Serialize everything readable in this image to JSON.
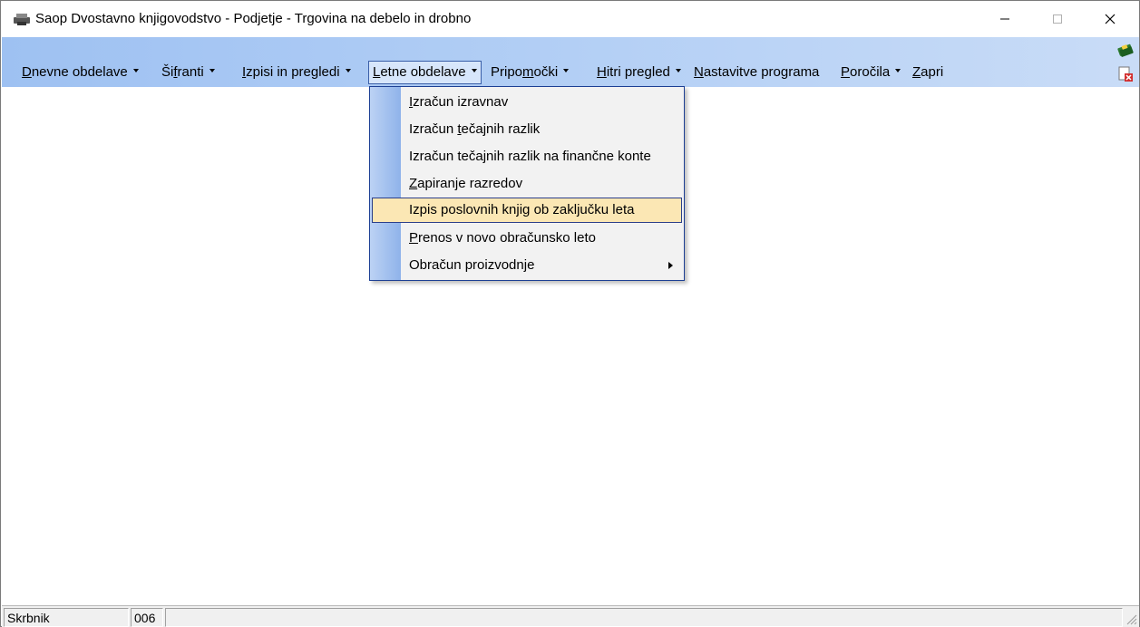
{
  "window": {
    "title": "Saop Dvostavno knjigovodstvo - Podjetje - Trgovina na debelo in drobno",
    "app_icon": "printer-icon"
  },
  "menubar": {
    "items": [
      {
        "pre": "",
        "u": "D",
        "post": "nevne obdelave",
        "has_caret": true
      },
      {
        "pre": "Ši",
        "u": "f",
        "post": "ranti",
        "has_caret": true
      },
      {
        "pre": "",
        "u": "I",
        "post": "zpisi in pregledi",
        "has_caret": true
      },
      {
        "pre": "",
        "u": "L",
        "post": "etne obdelave",
        "has_caret": true
      },
      {
        "pre": "Pripo",
        "u": "m",
        "post": "očki",
        "has_caret": true
      },
      {
        "pre": "",
        "u": "H",
        "post": "itri pregled",
        "has_caret": true
      },
      {
        "pre": "",
        "u": "N",
        "post": "astavitve programa",
        "has_caret": false
      },
      {
        "pre": "",
        "u": "P",
        "post": "oročila",
        "has_caret": true
      },
      {
        "pre": "",
        "u": "Z",
        "post": "apri",
        "has_caret": false
      }
    ],
    "active_index": 3
  },
  "toolbar_icons": [
    "books-icon",
    "close-document-icon"
  ],
  "dropdown": {
    "items": [
      {
        "pre": "",
        "u": "I",
        "post": "zračun izravnav",
        "has_submenu": false
      },
      {
        "pre": "Izračun ",
        "u": "t",
        "post": "ečajnih razlik",
        "has_submenu": false
      },
      {
        "pre": "Izračun tečajnih razlik na finančne konte",
        "u": "",
        "post": "",
        "has_submenu": false
      },
      {
        "pre": "",
        "u": "Z",
        "post": "apiranje razredov",
        "has_submenu": false
      },
      {
        "pre": "Izpis poslovnih knjig ob zaključku leta",
        "u": "",
        "post": "",
        "has_submenu": false
      },
      {
        "pre": "",
        "u": "P",
        "post": "renos v novo obračunsko leto",
        "has_submenu": false
      },
      {
        "pre": "Obračun proizvodnje",
        "u": "",
        "post": "",
        "has_submenu": true
      }
    ],
    "highlighted_index": 4
  },
  "statusbar": {
    "user": "Skrbnik",
    "code": "006",
    "message": ""
  },
  "colors": {
    "menubar_gradient_start": "#9ec1f2",
    "menubar_gradient_end": "#c9dcf7",
    "highlight": "#fbe7b4",
    "highlight_border": "#2b3f8a"
  }
}
